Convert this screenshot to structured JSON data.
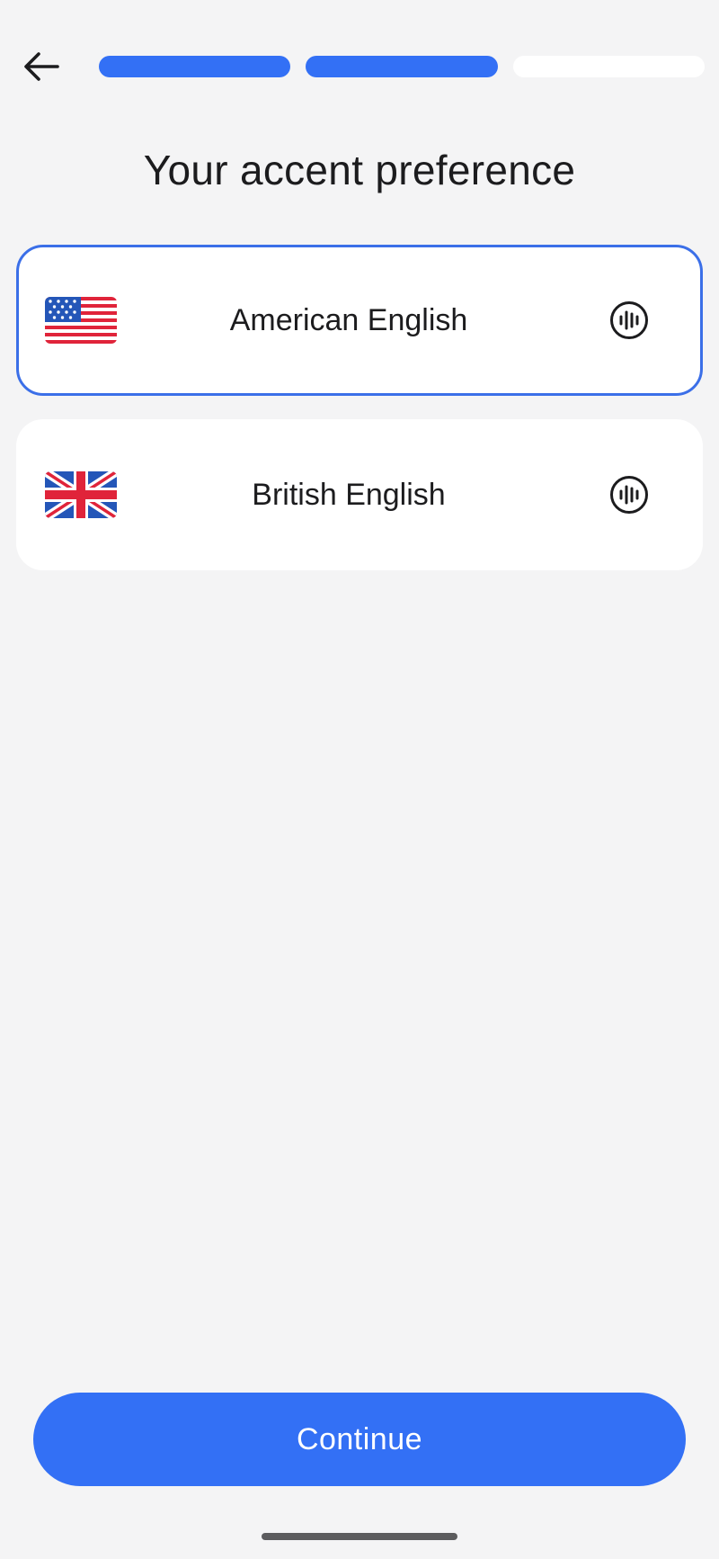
{
  "header": {
    "back_icon": "arrow-left-icon",
    "progress": {
      "total_steps": 3,
      "completed_steps": 2
    }
  },
  "title": "Your accent preference",
  "options": [
    {
      "label": "American English",
      "flag_icon": "us-flag-icon",
      "audio_icon": "audio-waveform-icon",
      "selected": true
    },
    {
      "label": "British English",
      "flag_icon": "uk-flag-icon",
      "audio_icon": "audio-waveform-icon",
      "selected": false
    }
  ],
  "continue_label": "Continue",
  "colors": {
    "accent": "#3370f5",
    "selected_border": "#3b6fe8",
    "background": "#f4f4f5",
    "card": "#ffffff",
    "text": "#1c1c1e"
  }
}
